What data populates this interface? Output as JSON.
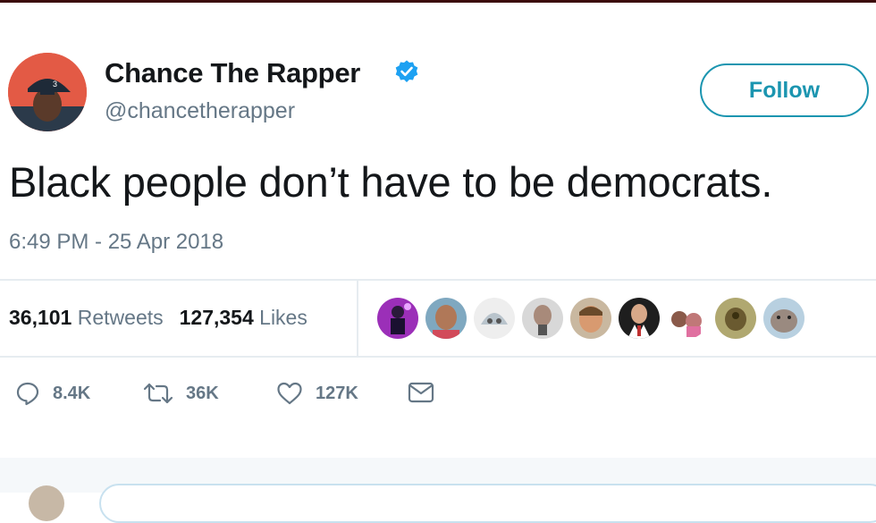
{
  "user": {
    "name": "Chance The Rapper",
    "handle": "@chancetherapper",
    "avatar_cap_number": "3"
  },
  "follow_label": "Follow",
  "tweet": {
    "text": "Black people don’t have to be democrats.",
    "timestamp": "6:49 PM - 25 Apr 2018"
  },
  "stats": {
    "retweets_count": "36,101",
    "retweets_label": "Retweets",
    "likes_count": "127,354",
    "likes_label": "Likes"
  },
  "actions": {
    "reply_count": "8.4K",
    "retweet_count": "36K",
    "like_count": "127K"
  },
  "icons": [
    "verified-icon",
    "reply-icon",
    "retweet-icon",
    "like-icon",
    "message-icon"
  ],
  "colors": {
    "accent": "#1b95b0",
    "verified": "#1da1f2",
    "muted": "#657786",
    "divider": "#e6ecf0"
  }
}
